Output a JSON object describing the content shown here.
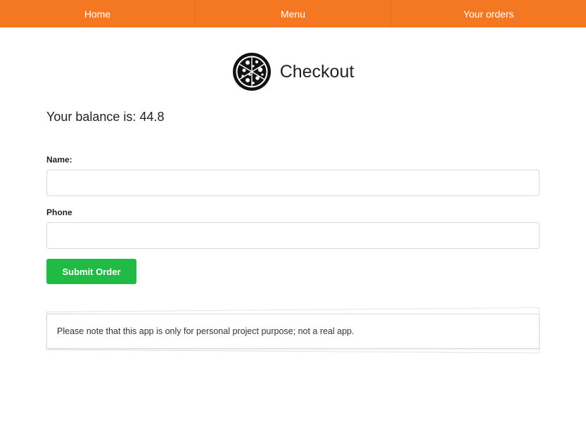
{
  "nav": {
    "items": [
      {
        "label": "Home"
      },
      {
        "label": "Menu"
      },
      {
        "label": "Your orders"
      }
    ],
    "color": "#f47721"
  },
  "header": {
    "title": "Checkout",
    "logo_icon": "pizza-icon"
  },
  "balance": {
    "label": "Your balance is:",
    "value": "44.8"
  },
  "form": {
    "name_label": "Name:",
    "name_value": "",
    "phone_label": "Phone",
    "phone_value": "",
    "submit_label": "Submit Order",
    "submit_color": "#21ba45"
  },
  "notice": {
    "text": "Please note that this app is only for personal project purpose; not a real app."
  }
}
